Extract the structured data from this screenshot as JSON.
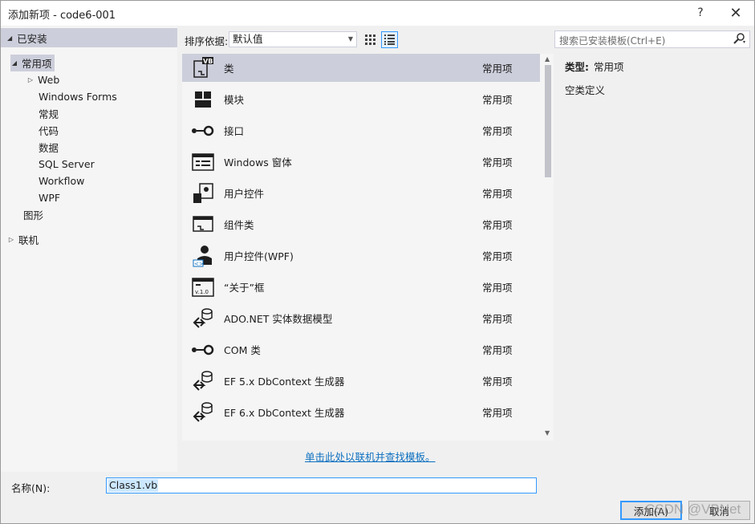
{
  "window": {
    "title": "添加新项 - code6-001",
    "help": "?",
    "close": "✕"
  },
  "tree": {
    "installed": "已安装",
    "common": "常用项",
    "children": [
      "Web",
      "Windows Forms",
      "常规",
      "代码",
      "数据",
      "SQL Server",
      "Workflow",
      "WPF"
    ],
    "graphics": "图形",
    "online": "联机"
  },
  "sort": {
    "label": "排序依据:",
    "value": "默认值"
  },
  "templates": [
    {
      "name": "类",
      "category": "常用项",
      "icon": "vb-class-icon"
    },
    {
      "name": "模块",
      "category": "常用项",
      "icon": "module-icon"
    },
    {
      "name": "接口",
      "category": "常用项",
      "icon": "interface-icon"
    },
    {
      "name": "Windows 窗体",
      "category": "常用项",
      "icon": "windows-form-icon"
    },
    {
      "name": "用户控件",
      "category": "常用项",
      "icon": "user-control-icon"
    },
    {
      "name": "组件类",
      "category": "常用项",
      "icon": "component-class-icon"
    },
    {
      "name": "用户控件(WPF)",
      "category": "常用项",
      "icon": "wpf-user-control-icon"
    },
    {
      "name": "“关于”框",
      "category": "常用项",
      "icon": "about-box-icon"
    },
    {
      "name": "ADO.NET 实体数据模型",
      "category": "常用项",
      "icon": "entity-model-icon"
    },
    {
      "name": "COM 类",
      "category": "常用项",
      "icon": "com-class-icon"
    },
    {
      "name": "EF 5.x DbContext 生成器",
      "category": "常用项",
      "icon": "dbcontext-icon"
    },
    {
      "name": "EF 6.x DbContext 生成器",
      "category": "常用项",
      "icon": "dbcontext-icon"
    }
  ],
  "online_link": "单击此处以联机并查找模板。",
  "search": {
    "placeholder": "搜索已安装模板(Ctrl+E)"
  },
  "detail": {
    "type_label": "类型:",
    "type_value": "常用项",
    "description": "空类定义"
  },
  "name_field": {
    "label": "名称(N):",
    "value": "Class1.vb"
  },
  "buttons": {
    "add": "添加(A)",
    "cancel": "取消"
  },
  "watermark": "CSDN @VBNet",
  "colors": {
    "selection": "#cccedb",
    "accent": "#3399ff",
    "link": "#0e70c0"
  }
}
